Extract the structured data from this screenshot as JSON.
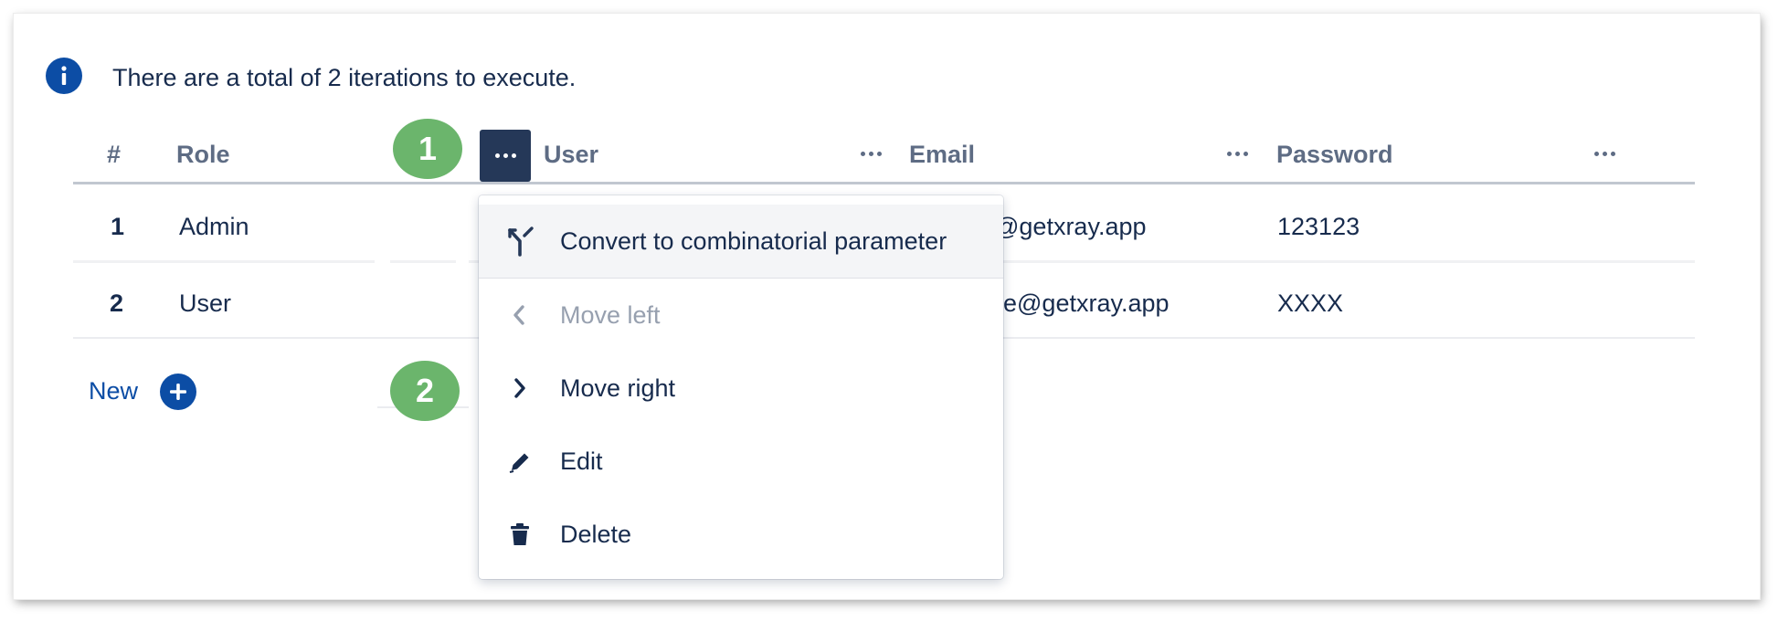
{
  "info": {
    "icon": "info-icon",
    "text": "There are a total of 2 iterations to execute."
  },
  "table": {
    "headers": {
      "index": "#",
      "role": "Role",
      "user": "User",
      "email": "Email",
      "password": "Password"
    },
    "rows": [
      {
        "index": "1",
        "role": "Admin",
        "email": "@getxray.app",
        "password": "123123"
      },
      {
        "index": "2",
        "role": "User",
        "email": "e@getxray.app",
        "password": "XXXX"
      }
    ],
    "new_label": "New"
  },
  "badges": [
    "1",
    "2"
  ],
  "menu": {
    "items": [
      {
        "label": "Convert to combinatorial parameter",
        "icon": "combinatorial-icon",
        "state": "hover"
      },
      {
        "label": "Move left",
        "icon": "chevron-left-icon",
        "state": "disabled"
      },
      {
        "label": "Move right",
        "icon": "chevron-right-icon",
        "state": "enabled"
      },
      {
        "label": "Edit",
        "icon": "pencil-icon",
        "state": "enabled"
      },
      {
        "label": "Delete",
        "icon": "trash-icon",
        "state": "enabled"
      }
    ]
  },
  "colors": {
    "accent": "#0c4da5",
    "text": "#172b4d",
    "header_text": "#5e6c84",
    "badge": "#6bb56c",
    "active_button": "#253858",
    "disabled_text": "#97a0af"
  }
}
